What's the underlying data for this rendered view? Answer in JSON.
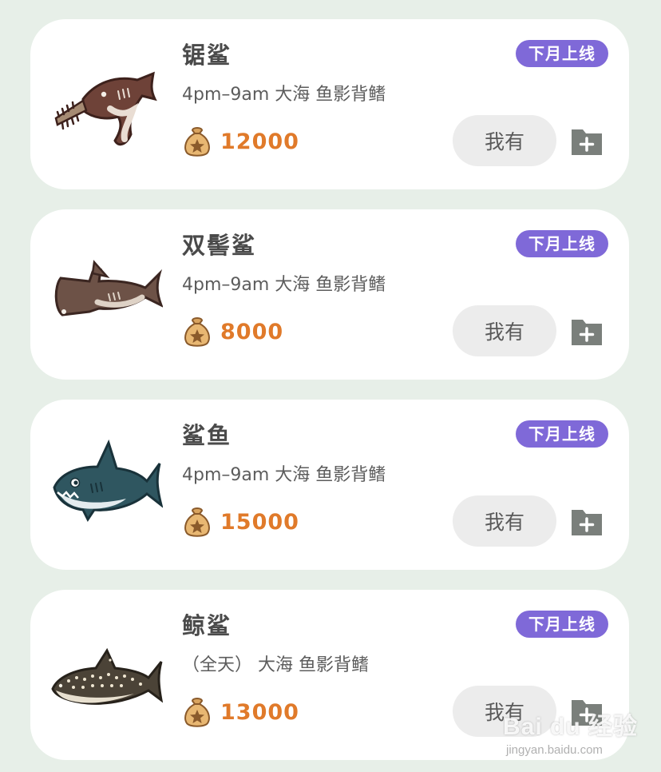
{
  "fish": [
    {
      "name": "锯鲨",
      "desc": "4pm–9am 大海 鱼影背鳍",
      "price": "12000",
      "badge": "下月上线",
      "own_label": "我有",
      "image_icon": "sawshark-icon"
    },
    {
      "name": "双髻鲨",
      "desc": "4pm–9am 大海 鱼影背鳍",
      "price": "8000",
      "badge": "下月上线",
      "own_label": "我有",
      "image_icon": "hammerhead-icon"
    },
    {
      "name": "鲨鱼",
      "desc": "4pm–9am 大海 鱼影背鳍",
      "price": "15000",
      "badge": "下月上线",
      "own_label": "我有",
      "image_icon": "shark-icon"
    },
    {
      "name": "鲸鲨",
      "desc": "（全天） 大海 鱼影背鳍",
      "price": "13000",
      "badge": "下月上线",
      "own_label": "我有",
      "image_icon": "whale-shark-icon"
    }
  ],
  "watermark": {
    "brand": "Bai du 经验",
    "url": "jingyan.baidu.com"
  },
  "colors": {
    "background": "#e7efe8",
    "badge": "#7f69d8",
    "price": "#e07a2a",
    "button_bg": "#ececec",
    "folder": "#7a7f7b"
  }
}
